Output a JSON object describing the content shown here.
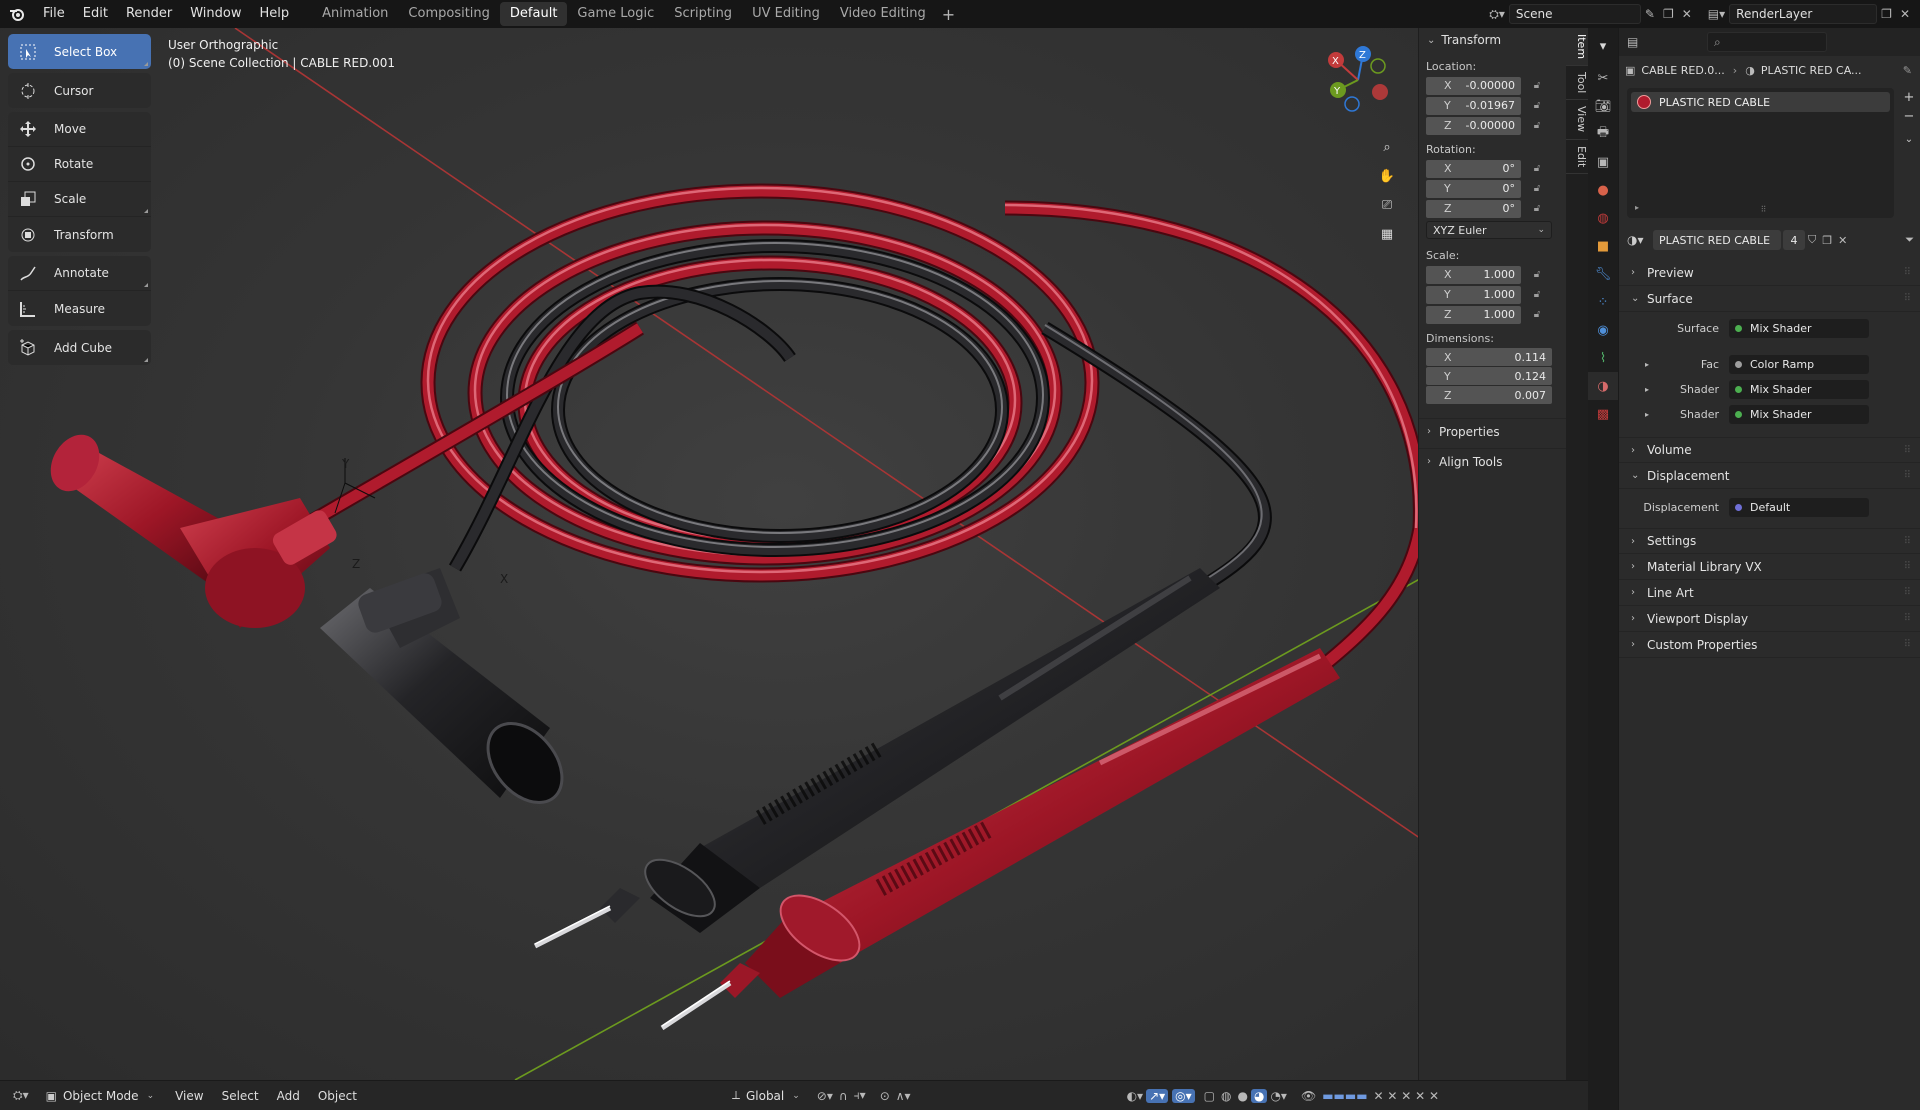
{
  "menu": [
    "File",
    "Edit",
    "Render",
    "Window",
    "Help"
  ],
  "workspaces": [
    "Animation",
    "Compositing",
    "Default",
    "Game Logic",
    "Scripting",
    "UV Editing",
    "Video Editing"
  ],
  "active_workspace": "Default",
  "scene_name": "Scene",
  "view_layer": "RenderLayer",
  "viewport": {
    "view_name": "User Orthographic",
    "collection_path": "(0) Scene Collection | CABLE RED.001",
    "gizmo": {
      "z": "Z",
      "y": "Y",
      "x": "X"
    }
  },
  "tools": [
    {
      "label": "Select Box",
      "icon": "select-box-icon",
      "active": true
    },
    {
      "label": "Cursor",
      "icon": "cursor-icon"
    },
    {
      "label": "Move",
      "icon": "move-icon"
    },
    {
      "label": "Rotate",
      "icon": "rotate-icon"
    },
    {
      "label": "Scale",
      "icon": "scale-icon"
    },
    {
      "label": "Transform",
      "icon": "transform-icon"
    },
    {
      "label": "Annotate",
      "icon": "annotate-icon"
    },
    {
      "label": "Measure",
      "icon": "measure-icon"
    },
    {
      "label": "Add Cube",
      "icon": "add-cube-icon"
    }
  ],
  "npanel": {
    "tabs": [
      "Item",
      "Tool",
      "View",
      "Edit"
    ],
    "header": "Transform",
    "location_label": "Location:",
    "location": [
      {
        "axis": "X",
        "value": "-0.00000"
      },
      {
        "axis": "Y",
        "value": "-0.01967"
      },
      {
        "axis": "Z",
        "value": "-0.00000"
      }
    ],
    "rotation_label": "Rotation:",
    "rotation": [
      {
        "axis": "X",
        "value": "0°"
      },
      {
        "axis": "Y",
        "value": "0°"
      },
      {
        "axis": "Z",
        "value": "0°"
      }
    ],
    "rotation_mode": "XYZ Euler",
    "scale_label": "Scale:",
    "scale": [
      {
        "axis": "X",
        "value": "1.000"
      },
      {
        "axis": "Y",
        "value": "1.000"
      },
      {
        "axis": "Z",
        "value": "1.000"
      }
    ],
    "dimensions_label": "Dimensions:",
    "dimensions": [
      {
        "axis": "X",
        "value": "0.114"
      },
      {
        "axis": "Y",
        "value": "0.124"
      },
      {
        "axis": "Z",
        "value": "0.007"
      }
    ],
    "properties": "Properties",
    "align_tools": "Align Tools"
  },
  "properties": {
    "breadcrumb_object": "CABLE RED.0...",
    "breadcrumb_material": "PLASTIC RED CA...",
    "slot": "PLASTIC RED CABLE",
    "material_name": "PLASTIC RED CABLE",
    "users": "4",
    "sections": {
      "preview": "Preview",
      "surface": "Surface",
      "volume": "Volume",
      "displacement": "Displacement",
      "settings": "Settings",
      "matlib": "Material Library VX",
      "lineart": "Line Art",
      "viewport_display": "Viewport Display",
      "custom_props": "Custom Properties"
    },
    "surface_rows": [
      {
        "label": "Surface",
        "value": "Mix Shader",
        "color": "#4caf50"
      },
      {
        "label": "Fac",
        "value": "Color Ramp",
        "color": "#9e9e9e"
      },
      {
        "label": "Shader",
        "value": "Mix Shader",
        "color": "#4caf50"
      },
      {
        "label": "Shader",
        "value": "Mix Shader",
        "color": "#4caf50"
      }
    ],
    "displacement_row": {
      "label": "Displacement",
      "value": "Default",
      "color": "#6f6fd6"
    }
  },
  "bottombar": {
    "mode": "Object Mode",
    "menus": [
      "View",
      "Select",
      "Add",
      "Object"
    ],
    "transform_orientation": "Global"
  },
  "colors": {
    "accent": "#4772b3",
    "cable_red": "#a8182a",
    "cable_black": "#1c1c1e",
    "axis_red": "#c23b3b",
    "axis_green": "#6c9a1f",
    "axis_blue": "#2f78d6"
  }
}
